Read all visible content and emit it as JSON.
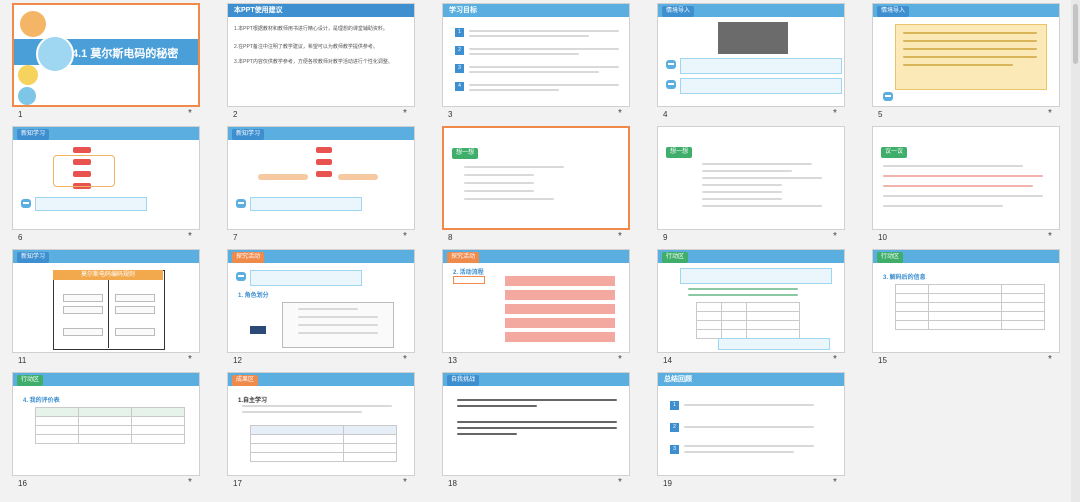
{
  "slides": [
    {
      "n": "1",
      "title": "4.1 莫尔斯电码的秘密"
    },
    {
      "n": "2",
      "title": "本PPT使用建议",
      "lines": [
        "1.本PPT根据教材和教师用书进行精心设计，是理想的课堂辅助资料。",
        "2.在PPT备注中注明了教学建议，希望可以为教师教学提供参考。",
        "3.本PPT内容仅供教学参考，方便各校教师对教学活动进行个性化调整。"
      ]
    },
    {
      "n": "3",
      "title": "学习目标",
      "items": [
        "1",
        "2",
        "3",
        "4"
      ]
    },
    {
      "n": "4",
      "badge": "情境导入"
    },
    {
      "n": "5",
      "badge": "情境导入"
    },
    {
      "n": "6",
      "badge": "新知学习"
    },
    {
      "n": "7",
      "badge": "新知学习"
    },
    {
      "n": "8",
      "badge": "想一想"
    },
    {
      "n": "9",
      "badge": "想一想"
    },
    {
      "n": "10",
      "badge": "议一议"
    },
    {
      "n": "11",
      "badge": "新知学习",
      "diagram_title": "莫尔斯电码编码规则"
    },
    {
      "n": "12",
      "badge": "探究活动",
      "section": "1. 角色划分"
    },
    {
      "n": "13",
      "badge": "探究活动",
      "section": "2. 活动流程"
    },
    {
      "n": "14",
      "badge": "行动区"
    },
    {
      "n": "15",
      "badge": "行动区",
      "section": "3. 解码后的信息"
    },
    {
      "n": "16",
      "badge": "行动区",
      "section": "4. 我的评价表"
    },
    {
      "n": "17",
      "badge": "成果区",
      "section": "1.自主学习"
    },
    {
      "n": "18",
      "badge": "自我挑战"
    },
    {
      "n": "19",
      "title": "总结回顾",
      "items": [
        "1",
        "2",
        "3"
      ]
    }
  ]
}
